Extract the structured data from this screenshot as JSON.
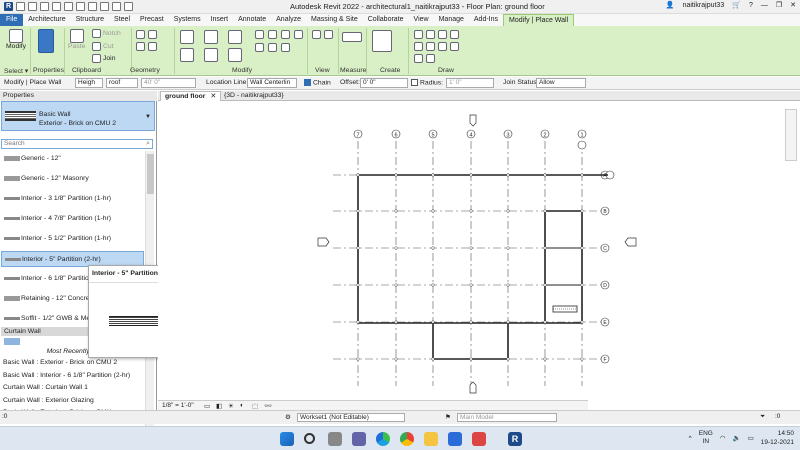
{
  "window": {
    "title": "Autodesk Revit 2022 - architectural1_naitikrajput33 - Floor Plan: ground floor",
    "user": "naitikrajput33"
  },
  "ribbon_tabs": [
    "File",
    "Architecture",
    "Structure",
    "Steel",
    "Precast",
    "Systems",
    "Insert",
    "Annotate",
    "Analyze",
    "Massing & Site",
    "Collaborate",
    "View",
    "Manage",
    "Add-Ins",
    "Modify | Place Wall"
  ],
  "ribbon": {
    "modify_label": "Modify",
    "paste_label": "Paste",
    "notch_label": "Notch",
    "cut_label": "Cut",
    "join_label": "Join",
    "panels": [
      "Select",
      "Properties",
      "Clipboard",
      "Geometry",
      "Modify",
      "View",
      "Measure",
      "Create",
      "Draw"
    ],
    "select_label": "Select ▾"
  },
  "options_bar": {
    "context": "Modify | Place Wall",
    "height_label": "Heigh",
    "height_value": "roof",
    "height_offset": "40' 0\"",
    "location_line_label": "Location Line:",
    "location_line_value": "Wall Centerlin",
    "chain_label": "Chain",
    "offset_label": "Offset:",
    "offset_value": "0' 0\"",
    "radius_label": "Radius:",
    "radius_value": "1' 0\"",
    "join_status_label": "Join Status:",
    "join_status_value": "Allow"
  },
  "properties": {
    "header": "Properties",
    "type_family": "Basic Wall",
    "type_name": "Exterior - Brick on CMU 2",
    "search_placeholder": "Search",
    "items": [
      "Generic - 12\"",
      "Generic - 12\" Masonry",
      "Interior - 3 1/8\" Partition (1-hr)",
      "Interior - 4 7/8\" Partition (1-hr)",
      "Interior - 5 1/2\" Partition (1-hr)",
      "Interior - 5\" Partition (2-hr)",
      "Interior - 6 1/8\" Partition (2-hr)",
      "Retaining - 12\" Concrete",
      "Soffit - 1/2\" GWB & Metal Stud"
    ],
    "group_curtain": "Curtain Wall",
    "mru_header": "Most Recently Used",
    "mru_items": [
      "Basic Wall : Exterior - Brick on CMU 2",
      "Basic Wall : Interior - 6 1/8\" Partition (2-hr)",
      "Curtain Wall : Curtain Wall 1",
      "Curtain Wall : Exterior Glazing",
      "Basic Wall : Exterior - Brick on CMU"
    ]
  },
  "tooltip": {
    "title": "Interior - 5\" Partition (2-hr) : R15"
  },
  "view_tabs": [
    {
      "label": "ground floor"
    },
    {
      "label": "{3D - naitikrajput33}"
    }
  ],
  "grid_columns": [
    "7",
    "6",
    "5",
    "4",
    "3",
    "2",
    "1"
  ],
  "grid_rows": [
    "A",
    "B",
    "C",
    "D",
    "E",
    "F"
  ],
  "view_control": {
    "scale": "1/8\" = 1'-0\""
  },
  "status_bar": {
    "workset": "Workset1 (Not Editable)",
    "design_option": "Main Model",
    "coord": ":0"
  },
  "tray": {
    "language": "ENG",
    "region": "IN",
    "time": "14:50",
    "date": "19-12-2021"
  },
  "colors": {
    "ribbon_bg": "#d9f0c6",
    "file_tab": "#2f6db5",
    "selection": "#bcd8f3"
  }
}
